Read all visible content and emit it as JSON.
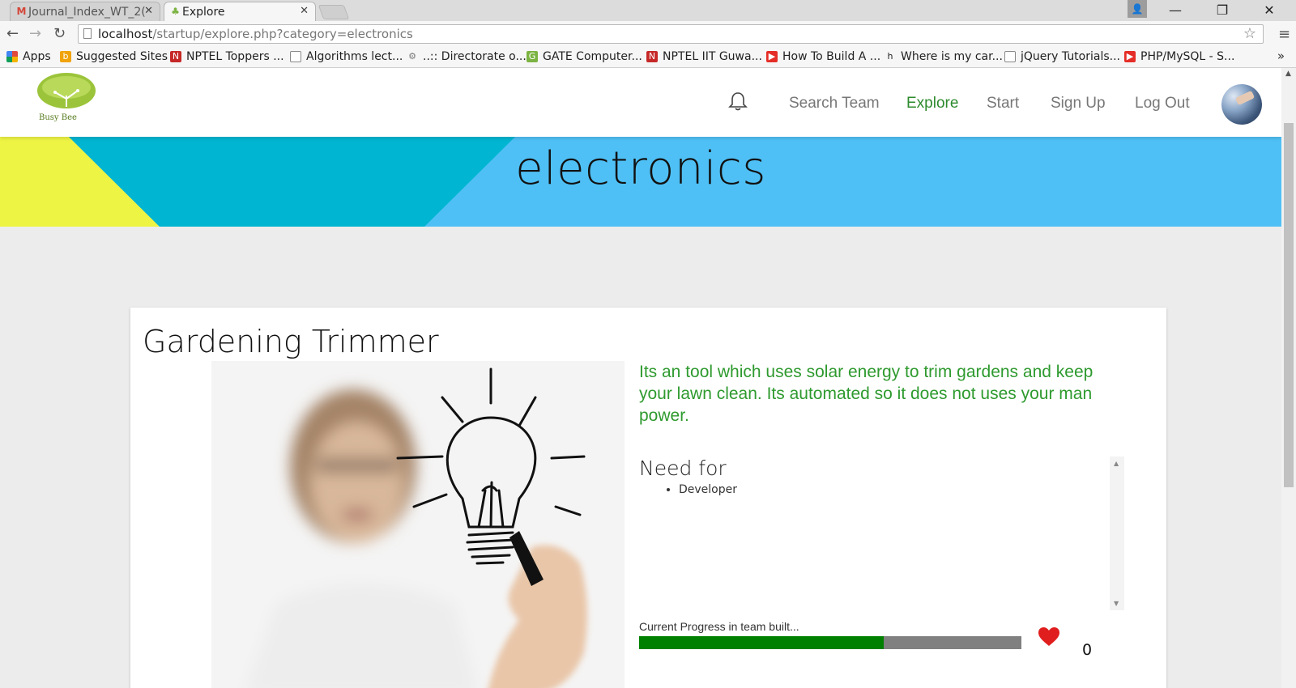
{
  "browser": {
    "tabs": [
      {
        "title": "Journal_Index_WT_2(",
        "active": false,
        "icon": "gmail-icon"
      },
      {
        "title": "Explore",
        "active": true,
        "icon": "tree-icon"
      }
    ],
    "url_host": "localhost",
    "url_path": "/startup/explore.php?category=electronics",
    "bookmarks": [
      {
        "label": "Apps",
        "icon": "apps-grid-icon",
        "color": "#e04a3f"
      },
      {
        "label": "Suggested Sites",
        "icon": "bing-icon",
        "color": "#f0a30a"
      },
      {
        "label": "NPTEL Toppers ...",
        "icon": "nptel-icon",
        "color": "#c62828"
      },
      {
        "label": "Algorithms lect...",
        "icon": "page-icon",
        "color": "#ffffff"
      },
      {
        "label": "..:: Directorate o...",
        "icon": "gear-icon",
        "color": "#9e9e9e"
      },
      {
        "label": "GATE Computer...",
        "icon": "gate-icon",
        "color": "#7cb342"
      },
      {
        "label": "NPTEL IIT Guwa...",
        "icon": "nptel-icon",
        "color": "#c62828"
      },
      {
        "label": "How To Build A ...",
        "icon": "youtube-icon",
        "color": "#e52d27"
      },
      {
        "label": "Where is my car...",
        "icon": "ch-icon",
        "color": "#222222"
      },
      {
        "label": "jQuery Tutorials...",
        "icon": "page-icon",
        "color": "#ffffff"
      },
      {
        "label": "PHP/MySQL - S...",
        "icon": "youtube-icon",
        "color": "#e52d27"
      }
    ],
    "more_label": "»"
  },
  "header": {
    "logo_text": "Busy Bee",
    "nav": [
      {
        "label": "Search Team",
        "active": false
      },
      {
        "label": "Explore",
        "active": true
      },
      {
        "label": "Start",
        "active": false
      },
      {
        "label": "Sign Up",
        "active": false
      },
      {
        "label": "Log Out",
        "active": false
      }
    ],
    "accent_color": "#2e8b2e"
  },
  "banner": {
    "title": "electronics",
    "colors": [
      "#eef443",
      "#00b5d1",
      "#4fc0f5"
    ]
  },
  "card": {
    "title": "Gardening Trimmer",
    "description": "Its an tool which uses solar energy to trim gardens and keep your lawn clean. Its automated so it does not uses your man power.",
    "need_title": "Need for",
    "needs": [
      "Developer"
    ],
    "progress_label": "Current Progress in team built...",
    "progress": 0.64,
    "likes": "0"
  }
}
